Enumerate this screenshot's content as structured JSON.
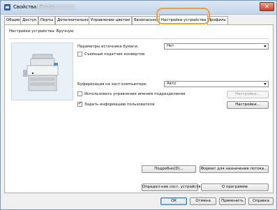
{
  "window": {
    "title": "Свойства: Canon"
  },
  "tabs": [
    "Общие",
    "Доступ",
    "Порты",
    "Дополнительно",
    "Управление цветом",
    "Безопасност",
    "Настройки устройства",
    "Профиль"
  ],
  "panel": {
    "header": "Настройки устройства: Вручную",
    "paper_source_label": "Параметры источника бумаги:",
    "paper_source_value": "Нет",
    "envelope_feeder_label": "Съемный податчик конвертов",
    "spooling_label": "Буферизация на хост-компьютере:",
    "spooling_value": "Авто",
    "dept_mgmt_label": "Использовать управление именем подразделения",
    "dept_settings_button": "Настройки...",
    "user_info_label": "Задать информацию пользователя",
    "user_settings_button": "Настройки...",
    "details_button": "Подробно(D)...",
    "output_format_button": "Формат для назначения потока...",
    "get_status_button": "Определ-ние сост. устройства",
    "about_button": "О программе"
  },
  "footer": {
    "ok": "OK",
    "cancel": "Отмена",
    "apply": "Применить",
    "help": "Справка"
  },
  "colors": {
    "highlight": "#f0a030",
    "titlebar": "#c4d6ea",
    "close": "#c7432b"
  }
}
